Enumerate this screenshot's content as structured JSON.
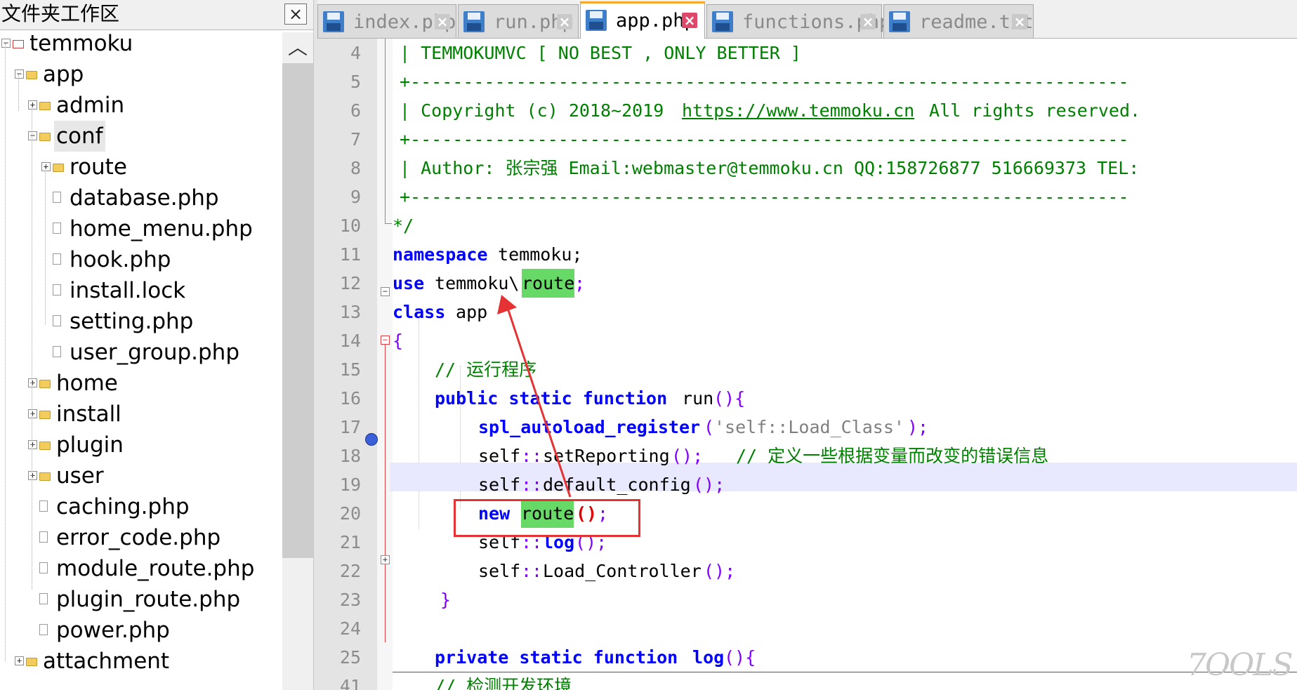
{
  "panel": {
    "title": "文件夹工作区",
    "close_glyph": "×"
  },
  "tree": [
    {
      "label": "temmoku",
      "kind": "root",
      "toggle": "−"
    },
    {
      "label": "app",
      "kind": "folder",
      "toggle": "−"
    },
    {
      "label": "admin",
      "kind": "folder",
      "toggle": "+"
    },
    {
      "label": "conf",
      "kind": "folder",
      "toggle": "−",
      "selected": true
    },
    {
      "label": "route",
      "kind": "folder",
      "toggle": "+"
    },
    {
      "label": "database.php",
      "kind": "file"
    },
    {
      "label": "home_menu.php",
      "kind": "file"
    },
    {
      "label": "hook.php",
      "kind": "file"
    },
    {
      "label": "install.lock",
      "kind": "file"
    },
    {
      "label": "setting.php",
      "kind": "file"
    },
    {
      "label": "user_group.php",
      "kind": "file"
    },
    {
      "label": "home",
      "kind": "folder",
      "toggle": "+"
    },
    {
      "label": "install",
      "kind": "folder",
      "toggle": "+"
    },
    {
      "label": "plugin",
      "kind": "folder",
      "toggle": "+"
    },
    {
      "label": "user",
      "kind": "folder",
      "toggle": "+"
    },
    {
      "label": "caching.php",
      "kind": "file"
    },
    {
      "label": "error_code.php",
      "kind": "file"
    },
    {
      "label": "module_route.php",
      "kind": "file"
    },
    {
      "label": "plugin_route.php",
      "kind": "file"
    },
    {
      "label": "power.php",
      "kind": "file"
    },
    {
      "label": "attachment",
      "kind": "folder",
      "toggle": "+"
    }
  ],
  "tabs": [
    {
      "label": "index.php",
      "active": false
    },
    {
      "label": "run.php",
      "active": false
    },
    {
      "label": "app.php",
      "active": true
    },
    {
      "label": "functions.php",
      "active": false
    },
    {
      "label": "readme.txt",
      "active": false
    }
  ],
  "code": {
    "line_numbers": [
      "4",
      "5",
      "6",
      "7",
      "8",
      "9",
      "10",
      "11",
      "12",
      "13",
      "14",
      "15",
      "16",
      "17",
      "18",
      "19",
      "20",
      "21",
      "22",
      "23",
      "24",
      "25",
      "41"
    ],
    "l4_text": "| TEMMOKUMVC [ NO BEST , ONLY BETTER ]",
    "l5_text": "+--------------------------------------------------------------------",
    "l6_pre": "| Copyright (c) 2018~2019 ",
    "l6_link": "https://www.temmoku.cn",
    "l6_post": " All rights reserved.",
    "l7_text": "+--------------------------------------------------------------------",
    "l8_text": "| Author: 张宗强 Email:webmaster@temmoku.cn QQ:158726877 516669373 TEL:",
    "l9_text": "+--------------------------------------------------------------------",
    "l10_text": "*/",
    "l11_kw": "namespace",
    "l11_rest": " temmoku;",
    "l12_kw": "use",
    "l12_ns": " temmoku\\",
    "l12_hl": "route",
    "l12_end": ";",
    "l13_kw": "class",
    "l13_rest": " app",
    "l14_brace": "{",
    "l15_comment": "// 运行程序",
    "l16_kw": "public static function",
    "l16_name": " run",
    "l16_paren": "(){",
    "l17_fn": "spl_autoload_register",
    "l17_open": "(",
    "l17_str": "'self::Load_Class'",
    "l17_close": ");",
    "l18_code": "self",
    "l18_op": "::",
    "l18_fn": "setReporting",
    "l18_paren": "();",
    "l18_comment": "// 定义一些根据变量而改变的错误信息",
    "l19_code": "self",
    "l19_op": "::",
    "l19_fn": "default_config",
    "l19_paren": "();",
    "l20_kw": "new",
    "l20_hl": "route",
    "l20_paren": "()",
    "l20_end": ";",
    "l21_code": "self",
    "l21_op": "::",
    "l21_fn": "log",
    "l21_paren": "();",
    "l22_code": "self",
    "l22_op": "::",
    "l22_fn": "Load_Controller",
    "l22_paren": "();",
    "l23_brace": "}",
    "l25_kw": "private static function",
    "l25_name": " log",
    "l25_paren": "(){",
    "l41_comment": "// 检测开发环境"
  },
  "watermark": "7OOLS",
  "colors": {
    "keyword": "#0000ff",
    "comment": "#008000",
    "operator": "#8000ff",
    "string": "#808080",
    "highlight": "#66d966",
    "annotation": "#e53333",
    "active_tab_accent": "#f6a82a"
  }
}
